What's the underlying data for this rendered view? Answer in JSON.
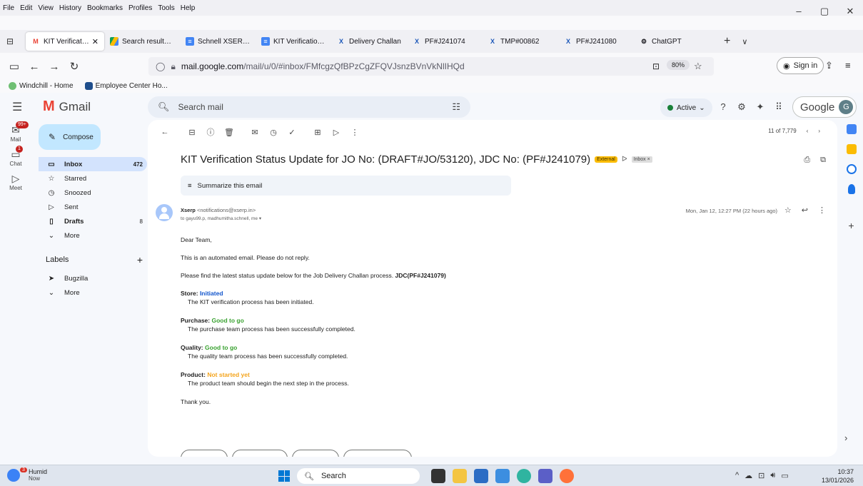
{
  "menubar": {
    "items": [
      "File",
      "Edit",
      "View",
      "History",
      "Bookmarks",
      "Profiles",
      "Tools",
      "Help"
    ],
    "window_controls": [
      "–",
      "▢",
      "✕"
    ]
  },
  "tabs": [
    {
      "label": "KIT Verification",
      "close": "✕",
      "icon": "gmail-icon",
      "active": true
    },
    {
      "label": "Search results - G",
      "icon": "drive-icon"
    },
    {
      "label": "Schnell XSERP - K",
      "icon": "docs-icon"
    },
    {
      "label": "KIT Verification - J",
      "icon": "docs-icon"
    },
    {
      "label": "Delivery Challan",
      "icon": "xserp-icon"
    },
    {
      "label": "PF#J241074",
      "icon": "xserp-icon"
    },
    {
      "label": "TMP#00862",
      "icon": "xserp-icon"
    },
    {
      "label": "PF#J241080",
      "icon": "xserp-icon"
    },
    {
      "label": "ChatGPT",
      "icon": "chatgpt-icon"
    }
  ],
  "navbar": {
    "url_host": "mail.google.com",
    "url_path": "/mail/u/0/#inbox/FMfcgzQfBPzCgZFQVJsnzBVnVkNlIHQd",
    "zoom": "80%",
    "signin": "Sign in"
  },
  "bookmarks": [
    "Windchill - Home",
    "Employee Center Ho..."
  ],
  "gmail": {
    "app_name": "Gmail",
    "search_placeholder": "Search mail",
    "status": "Active",
    "account_label": "Google",
    "account_initial": "G",
    "rail": [
      {
        "label": "Mail",
        "badge": "99+"
      },
      {
        "label": "Chat",
        "badge": "1"
      },
      {
        "label": "Meet",
        "badge": ""
      }
    ],
    "compose": "Compose",
    "nav": [
      {
        "label": "Inbox",
        "count": "472",
        "selected": true,
        "icon": "inbox-icon"
      },
      {
        "label": "Starred",
        "count": "",
        "icon": "star-icon"
      },
      {
        "label": "Snoozed",
        "count": "",
        "icon": "clock-icon"
      },
      {
        "label": "Sent",
        "count": "",
        "icon": "send-icon"
      },
      {
        "label": "Drafts",
        "count": "8",
        "icon": "draft-icon"
      },
      {
        "label": "More",
        "count": "",
        "icon": "chevron-down-icon"
      }
    ],
    "labels_title": "Labels",
    "labels": [
      {
        "label": "Bugzilla",
        "icon": "label-icon"
      },
      {
        "label": "More",
        "icon": "chevron-down-icon"
      }
    ]
  },
  "message": {
    "pager": "11 of 7,779",
    "subject": "KIT Verification Status Update for JO No: (DRAFT#JO/53120), JDC No: (PF#J241079)",
    "external_chip": "External",
    "inbox_chip": "Inbox ×",
    "summarize": "Summarize this email",
    "sender_name": "Xserp",
    "sender_email": "<notifications@xserp.in>",
    "to_line": "to gayu99.p, madhumitha.schnell, me ▾",
    "date": "Mon, Jan 12, 12:27 PM (22 hours ago)",
    "greeting": "Dear Team,",
    "line1": "This is an automated email. Please do not reply.",
    "line2_prefix": "Please find the latest status update below for the Job Delivery Challan process.",
    "line2_bold": "JDC(PF#J241079)",
    "statuses": [
      {
        "label": "Store:",
        "value": "Initiated",
        "desc": "The KIT verification process has been initiated."
      },
      {
        "label": "Purchase:",
        "value": "Good to go",
        "desc": "The purchase team process has been successfully completed."
      },
      {
        "label": "Quality:",
        "value": "Good to go",
        "desc": "The quality team process has been successfully completed."
      },
      {
        "label": "Product:",
        "value": "Not started yet",
        "desc": "The product team should begin the next step in the process."
      }
    ],
    "signoff": "Thank you."
  },
  "taskbar": {
    "weather_title": "Humid",
    "weather_sub": "Now",
    "weather_badge": "3",
    "search": "Search",
    "time": "10:37",
    "date": "13/01/2026"
  },
  "colors": {
    "initiated": "#1155cc",
    "good": "#38a12f",
    "not_started": "#f4a41c",
    "external_chip": "#fbbc04",
    "inbox_selected": "#d3e3fd",
    "compose": "#c2e7ff"
  }
}
